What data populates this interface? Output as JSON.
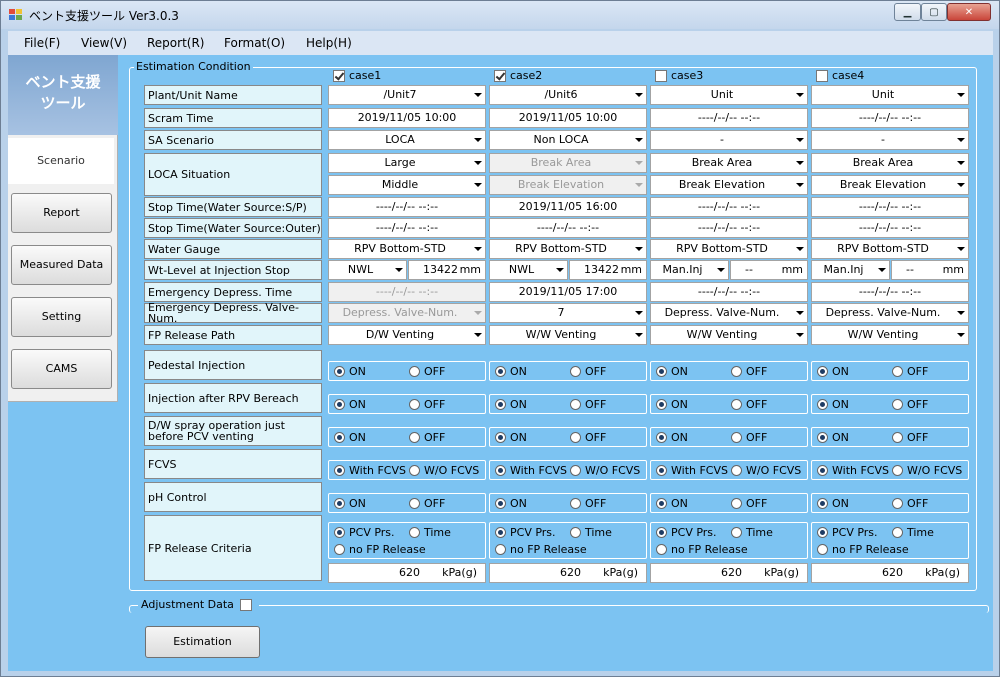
{
  "window": {
    "title": "ベント支援ツール Ver3.0.3"
  },
  "menu": [
    "File(F)",
    "View(V)",
    "Report(R)",
    "Format(O)",
    "Help(H)"
  ],
  "sidebar": {
    "header": "ベント支援\nツール",
    "active": "Scenario",
    "buttons": [
      "Report",
      "Measured Data",
      "Setting",
      "CAMS"
    ]
  },
  "group": {
    "label": "Estimation Condition"
  },
  "cases": [
    {
      "label": "case1",
      "checked": true
    },
    {
      "label": "case2",
      "checked": true
    },
    {
      "label": "case3",
      "checked": false
    },
    {
      "label": "case4",
      "checked": false
    }
  ],
  "labels": {
    "plant": "Plant/Unit Name",
    "scram": "Scram Time",
    "sa": "SA Scenario",
    "loca": "LOCA Situation",
    "stop_sp": "Stop Time(Water Source:S/P)",
    "stop_outer": "Stop Time(Water Source:Outer)",
    "gauge": "Water Gauge",
    "wtlevel": "Wt-Level at Injection Stop",
    "emtime": "Emergency Depress. Time",
    "emvalve": "Emergency Depress. Valve-Num.",
    "fppath": "FP Release Path",
    "pedestal": "Pedestal Injection",
    "rpv": "Injection after RPV Bereach",
    "dw": "D/W spray operation just before PCV venting",
    "fcvs": "FCVS",
    "ph": "pH Control",
    "fpcrit": "FP Release Criteria"
  },
  "values": {
    "plant": [
      "/Unit7",
      "/Unit6",
      "Unit",
      "Unit"
    ],
    "scram": [
      "2019/11/05 10:00",
      "2019/11/05 10:00",
      "----/--/-- --:--",
      "----/--/-- --:--"
    ],
    "sa": [
      "LOCA",
      "Non LOCA",
      "-",
      "-"
    ],
    "loca1": [
      "Large",
      "Break Area",
      "Break Area",
      "Break Area"
    ],
    "loca2": [
      "Middle",
      "Break Elevation",
      "Break Elevation",
      "Break Elevation"
    ],
    "stop_sp": [
      "----/--/-- --:--",
      "2019/11/05 16:00",
      "----/--/-- --:--",
      "----/--/-- --:--"
    ],
    "stop_outer": [
      "----/--/-- --:--",
      "----/--/-- --:--",
      "----/--/-- --:--",
      "----/--/-- --:--"
    ],
    "gauge": [
      "RPV Bottom-STD",
      "RPV Bottom-STD",
      "RPV Bottom-STD",
      "RPV Bottom-STD"
    ],
    "wt_type": [
      "NWL",
      "NWL",
      "Man.Inj",
      "Man.Inj"
    ],
    "wt_val": [
      "13422",
      "13422",
      "--",
      "--"
    ],
    "wt_unit": "mm",
    "emtime": [
      "----/--/-- --:--",
      "2019/11/05 17:00",
      "----/--/-- --:--",
      "----/--/-- --:--"
    ],
    "emvalve": [
      "Depress. Valve-Num.",
      "7",
      "Depress. Valve-Num.",
      "Depress. Valve-Num."
    ],
    "fppath": [
      "D/W Venting",
      "W/W Venting",
      "W/W Venting",
      "W/W Venting"
    ],
    "pressure": [
      "620",
      "620",
      "620",
      "620"
    ],
    "pressure_unit": "kPa(g)"
  },
  "radios": {
    "on": "ON",
    "off": "OFF",
    "with_fcvs": "With FCVS",
    "wo_fcvs": "W/O FCVS",
    "pcv_prs": "PCV Prs.",
    "time": "Time",
    "no_fp": "no FP Release"
  },
  "adjustment": {
    "label": "Adjustment Data"
  },
  "estimation_button": "Estimation"
}
